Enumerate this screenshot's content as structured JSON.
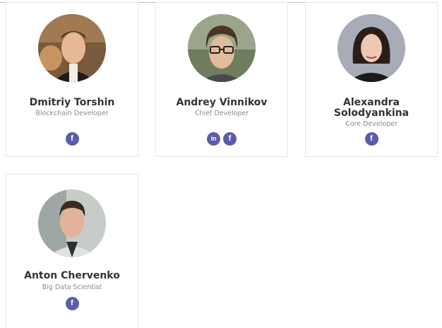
{
  "team": [
    {
      "name": "Dmitriy Torshin",
      "role": "Blockchain Developer",
      "socials": [
        {
          "icon": "facebook-icon",
          "glyph": "f"
        }
      ]
    },
    {
      "name": "Andrey Vinnikov",
      "role": "Chief Developer",
      "socials": [
        {
          "icon": "linkedin-icon",
          "glyph": "in"
        },
        {
          "icon": "facebook-icon",
          "glyph": "f"
        }
      ]
    },
    {
      "name": "Alexandra Solodyankina",
      "role": "Core Developer",
      "socials": [
        {
          "icon": "facebook-icon",
          "glyph": "f"
        }
      ]
    },
    {
      "name": "Anton Chervenko",
      "role": "Big Data Scientist",
      "socials": [
        {
          "icon": "facebook-icon",
          "glyph": "f"
        }
      ]
    }
  ],
  "colors": {
    "social_bg": "#5b5ea6",
    "name_text": "#333333",
    "role_text": "#8a8a8a",
    "card_border": "#e6e6e6"
  }
}
